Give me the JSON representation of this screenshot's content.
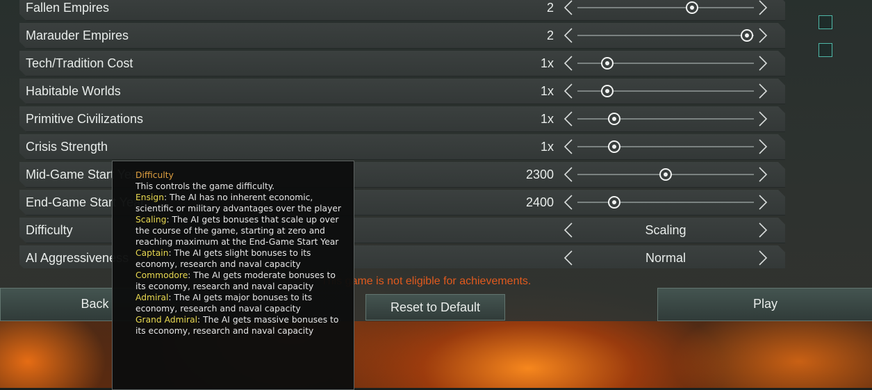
{
  "rows": [
    {
      "label": "Fallen Empires",
      "value": "2",
      "slider": 0.65
    },
    {
      "label": "Marauder Empires",
      "value": "2",
      "slider": 0.96
    },
    {
      "label": "Tech/Tradition Cost",
      "value": "1x",
      "slider": 0.17
    },
    {
      "label": "Habitable Worlds",
      "value": "1x",
      "slider": 0.17
    },
    {
      "label": "Primitive Civilizations",
      "value": "1x",
      "slider": 0.21
    },
    {
      "label": "Crisis Strength",
      "value": "1x",
      "slider": 0.21
    },
    {
      "label": "Mid-Game Start Year",
      "value": "2300",
      "slider": 0.5
    },
    {
      "label": "End-Game Start Year",
      "value": "2400",
      "slider": 0.21
    },
    {
      "label": "Difficulty",
      "selector_value": "Scaling"
    },
    {
      "label": "AI Aggressiveness",
      "selector_value": "Normal"
    }
  ],
  "buttons": {
    "back": "Back",
    "reset": "Reset to Default",
    "play": "Play"
  },
  "warning": "This game is not eligible for achievements.",
  "tooltip": {
    "title": "Difficulty",
    "intro": "This controls the game difficulty.",
    "levels": [
      {
        "name": "Ensign",
        "desc": ": The AI has no inherent economic, scientific or military advantages over the player"
      },
      {
        "name": "Scaling",
        "desc": ": The AI gets bonuses that scale up over the course of the game, starting at zero and reaching maximum at the End-Game Start Year"
      },
      {
        "name": "Captain",
        "desc": ": The AI gets slight bonuses to its economy, research and naval capacity"
      },
      {
        "name": "Commodore",
        "desc": ": The AI gets moderate bonuses to its economy, research and naval capacity"
      },
      {
        "name": "Admiral",
        "desc": ": The AI gets major bonuses to its economy, research and naval capacity"
      },
      {
        "name": "Grand Admiral",
        "desc": ": The AI gets massive bonuses to its economy, research and naval capacity"
      }
    ]
  },
  "icons": {
    "left_arrow": "chevron-left-icon",
    "right_arrow": "chevron-right-icon",
    "checkbox": "checkbox-icon"
  },
  "colors": {
    "accent": "#4fb8a8",
    "warning": "#e05a1e",
    "tooltip_title": "#e0a040",
    "tooltip_level": "#e8d850"
  }
}
